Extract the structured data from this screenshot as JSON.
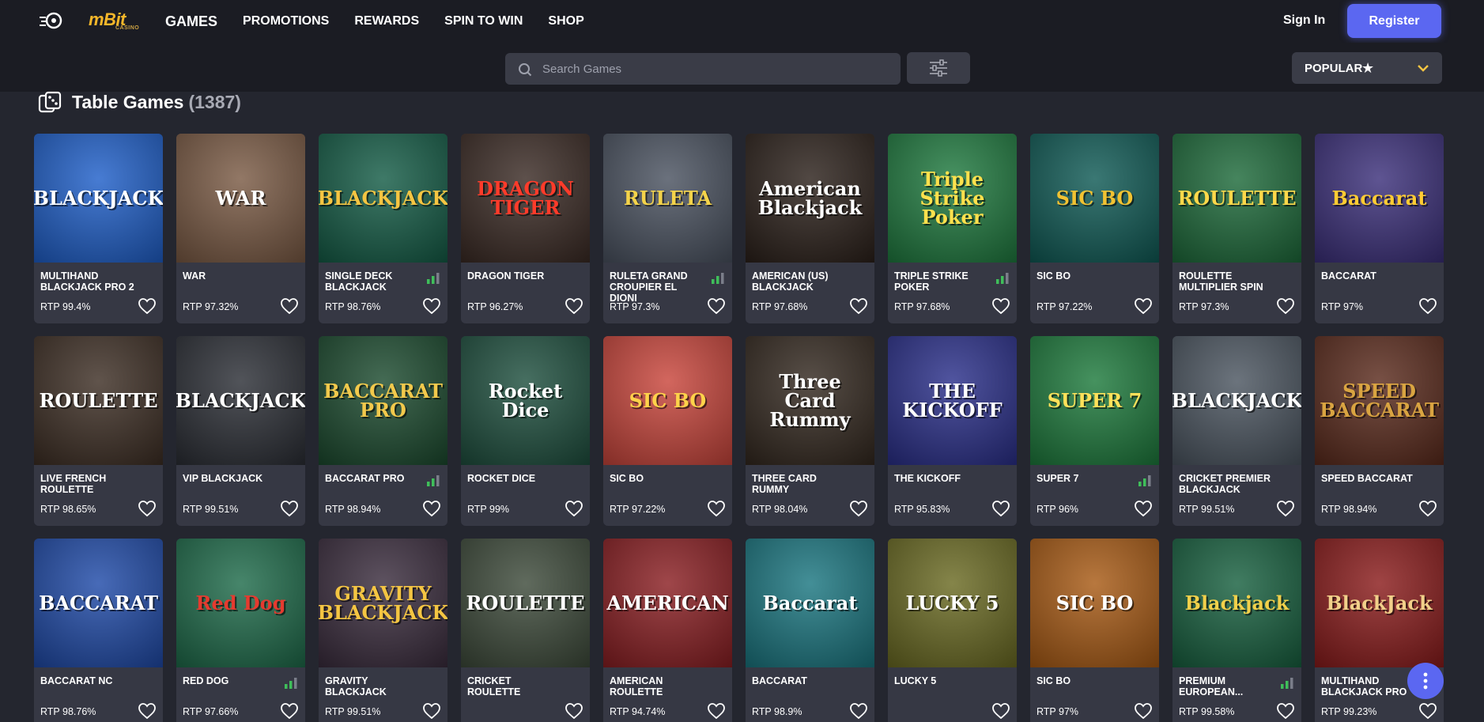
{
  "header": {
    "brand": "mBit",
    "brand_sub": "CASINO",
    "nav": [
      "GAMES",
      "PROMOTIONS",
      "REWARDS",
      "SPIN TO WIN",
      "SHOP"
    ],
    "signin": "Sign In",
    "register": "Register"
  },
  "toolbar": {
    "search_placeholder": "Search Games",
    "sort_label": "POPULAR"
  },
  "section": {
    "title": "Table Games",
    "count": "(1387)"
  },
  "games": [
    {
      "title": "MULTIHAND BLACKJACK PRO 2",
      "rtp": "RTP 99.4%",
      "art": "BLACKJACK",
      "bg": "#1f5fc9",
      "fg": "#ffffff",
      "bars": false
    },
    {
      "title": "WAR",
      "rtp": "RTP 97.32%",
      "art": "WAR",
      "bg": "#7a5a44",
      "fg": "#ffffff",
      "bars": false
    },
    {
      "title": "SINGLE DECK BLACKJACK",
      "rtp": "RTP 98.76%",
      "art": "BLACKJACK",
      "bg": "#145c46",
      "fg": "#f5c542",
      "bars": true
    },
    {
      "title": "DRAGON TIGER",
      "rtp": "RTP 96.27%",
      "art": "DRAGON TIGER",
      "bg": "#3a2a24",
      "fg": "#ff3b2a",
      "bars": false
    },
    {
      "title": "RULETA GRAND CROUPIER EL DIONI",
      "rtp": "RTP 97.3%",
      "art": "RULETA",
      "bg": "#4a5260",
      "fg": "#f4d34a",
      "bars": true
    },
    {
      "title": "AMERICAN (US) BLACKJACK",
      "rtp": "RTP 97.68%",
      "art": "American Blackjack",
      "bg": "#2b201a",
      "fg": "#ffffff",
      "bars": false
    },
    {
      "title": "TRIPLE STRIKE POKER",
      "rtp": "RTP 97.68%",
      "art": "Triple Strike Poker",
      "bg": "#1f7a3f",
      "fg": "#ffe14d",
      "bars": true
    },
    {
      "title": "SIC BO",
      "rtp": "RTP 97.22%",
      "art": "SIC BO",
      "bg": "#0f5a55",
      "fg": "#f1c232",
      "bars": false
    },
    {
      "title": "ROULETTE MULTIPLIER SPIN",
      "rtp": "RTP 97.3%",
      "art": "ROULETTE",
      "bg": "#1d6a3a",
      "fg": "#ffd84a",
      "bars": false
    },
    {
      "title": "BACCARAT",
      "rtp": "RTP 97%",
      "art": "Baccarat",
      "bg": "#3b2f7a",
      "fg": "#ffcc33",
      "bars": false
    },
    {
      "title": "LIVE FRENCH ROULETTE",
      "rtp": "RTP 98.65%",
      "art": "ROULETTE",
      "bg": "#3d2e24",
      "fg": "#ffffff",
      "bars": false
    },
    {
      "title": "VIP BLACKJACK",
      "rtp": "RTP 99.51%",
      "art": "BLACKJACK",
      "bg": "#2b2e35",
      "fg": "#ffffff",
      "bars": false
    },
    {
      "title": "BACCARAT PRO",
      "rtp": "RTP 98.94%",
      "art": "BACCARAT PRO",
      "bg": "#1b4a2e",
      "fg": "#f2c94c",
      "bars": true
    },
    {
      "title": "ROCKET DICE",
      "rtp": "RTP 99%",
      "art": "Rocket Dice",
      "bg": "#1e4f3e",
      "fg": "#ffffff",
      "bars": false
    },
    {
      "title": "SIC BO",
      "rtp": "RTP 97.22%",
      "art": "SIC BO",
      "bg": "#c9453b",
      "fg": "#ffd24a",
      "bars": false
    },
    {
      "title": "THREE CARD RUMMY",
      "rtp": "RTP 98.04%",
      "art": "Three Card Rummy",
      "bg": "#33281f",
      "fg": "#ffffff",
      "bars": false
    },
    {
      "title": "THE KICKOFF",
      "rtp": "RTP 95.83%",
      "art": "THE KICKOFF",
      "bg": "#2a2f8a",
      "fg": "#ffffff",
      "bars": false
    },
    {
      "title": "SUPER 7",
      "rtp": "RTP 96%",
      "art": "SUPER 7",
      "bg": "#1d7a3c",
      "fg": "#ffe15a",
      "bars": true
    },
    {
      "title": "CRICKET PREMIER BLACKJACK",
      "rtp": "RTP 99.51%",
      "art": "BLACKJACK",
      "bg": "#4b5560",
      "fg": "#ffffff",
      "bars": false
    },
    {
      "title": "SPEED BACCARAT",
      "rtp": "RTP 98.94%",
      "art": "SPEED BACCARAT",
      "bg": "#5a2a1c",
      "fg": "#d9a441",
      "bars": false
    },
    {
      "title": "BACCARAT NC",
      "rtp": "RTP 98.76%",
      "art": "BACCARAT",
      "bg": "#1f4aa8",
      "fg": "#ffffff",
      "bars": false
    },
    {
      "title": "RED DOG",
      "rtp": "RTP 97.66%",
      "art": "Red Dog",
      "bg": "#1e6b4a",
      "fg": "#e53a2f",
      "bars": true
    },
    {
      "title": "GRAVITY BLACKJACK",
      "rtp": "RTP 99.51%",
      "art": "GRAVITY BLACKJACK",
      "bg": "#3a2c3d",
      "fg": "#f4c542",
      "bars": false
    },
    {
      "title": "CRICKET ROULETTE",
      "rtp": "",
      "art": "ROULETTE",
      "bg": "#3d4a3a",
      "fg": "#ffffff",
      "bars": false
    },
    {
      "title": "AMERICAN ROULETTE",
      "rtp": "RTP 94.74%",
      "art": "AMERICAN",
      "bg": "#8a1e22",
      "fg": "#ffffff",
      "bars": false
    },
    {
      "title": "BACCARAT",
      "rtp": "RTP 98.9%",
      "art": "Baccarat",
      "bg": "#1a7680",
      "fg": "#ffffff",
      "bars": false
    },
    {
      "title": "LUCKY 5",
      "rtp": "",
      "art": "LUCKY 5",
      "bg": "#6a6a22",
      "fg": "#ffffff",
      "bars": false
    },
    {
      "title": "SIC BO",
      "rtp": "RTP 97%",
      "art": "SIC BO",
      "bg": "#a85a14",
      "fg": "#ffffff",
      "bars": false
    },
    {
      "title": "PREMIUM EUROPEAN...",
      "rtp": "RTP 99.58%",
      "art": "Blackjack",
      "bg": "#17603f",
      "fg": "#f2d04a",
      "bars": true
    },
    {
      "title": "MULTIHAND BLACKJACK PRO",
      "rtp": "RTP 99.23%",
      "art": "BlackJack",
      "bg": "#8a1b1b",
      "fg": "#f1d08a",
      "bars": false
    }
  ]
}
